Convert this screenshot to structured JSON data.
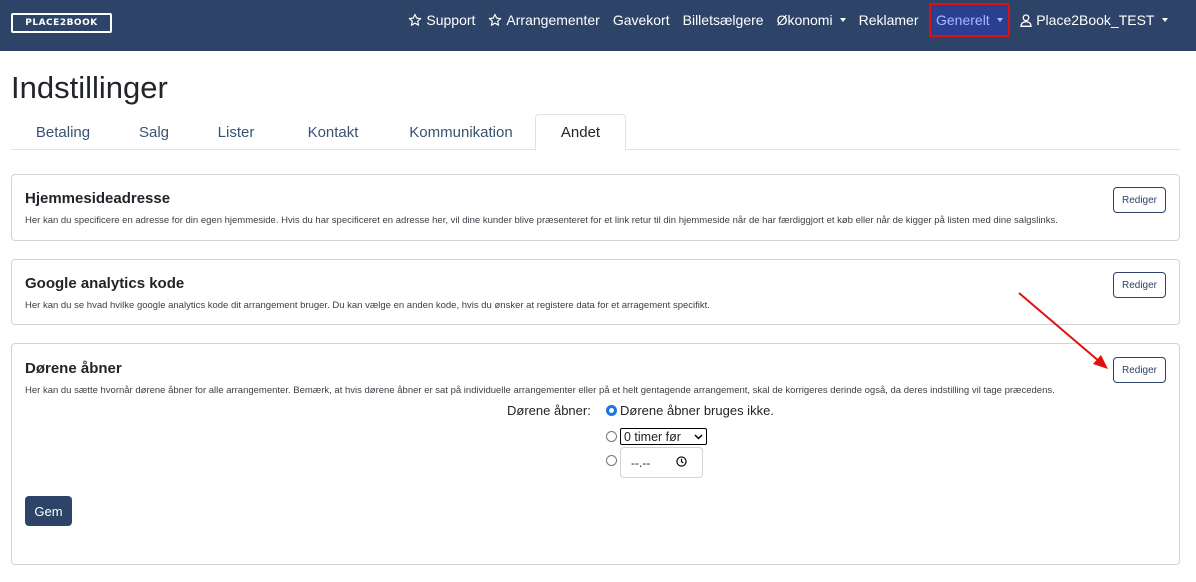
{
  "brand": {
    "logo_text": "PLACE2BOOK"
  },
  "nav": {
    "support": "Support",
    "arrangementer": "Arrangementer",
    "gavekort": "Gavekort",
    "billetsaelgere": "Billetsælgere",
    "okonomi": "Økonomi",
    "reklamer": "Reklamer",
    "generelt": "Generelt",
    "user": "Place2Book_TEST"
  },
  "page": {
    "title": "Indstillinger"
  },
  "tabs": [
    "Betaling",
    "Salg",
    "Lister",
    "Kontakt",
    "Kommunikation",
    "Andet"
  ],
  "active_tab": "Andet",
  "cards": {
    "website": {
      "title": "Hjemmesideadresse",
      "description": "Her kan du specificere en adresse for din egen hjemmeside. Hvis du har specificeret en adresse her, vil dine kunder blive præsenteret for et link retur til din hjemmeside når de har færdiggjort et køb eller når de kigger på listen med dine salgslinks.",
      "button": "Rediger"
    },
    "analytics": {
      "title": "Google analytics kode",
      "description": "Her kan du se hvad hvilke google analytics kode dit arrangement bruger. Du kan vælge en anden kode, hvis du ønsker at registere data for et arragement specifikt.",
      "button": "Rediger"
    },
    "doors": {
      "title": "Dørene åbner",
      "description": "Her kan du sætte hvornår dørene åbner for alle arrangementer. Bemærk, at hvis dørene åbner er sat på individuelle arrangementer eller på et helt gentagende arrangement, skal de korrigeres derinde også, da deres indstilling vil tage præcedens.",
      "button": "Rediger",
      "form_label": "Dørene åbner:",
      "option_none": "Dørene åbner bruges ikke.",
      "select_value": "0 timer før",
      "time_placeholder": "--.--",
      "save_button": "Gem"
    }
  },
  "colors": {
    "navbar": "#2d4468",
    "highlight": "#e01010",
    "primary_button": "#2d4468"
  }
}
